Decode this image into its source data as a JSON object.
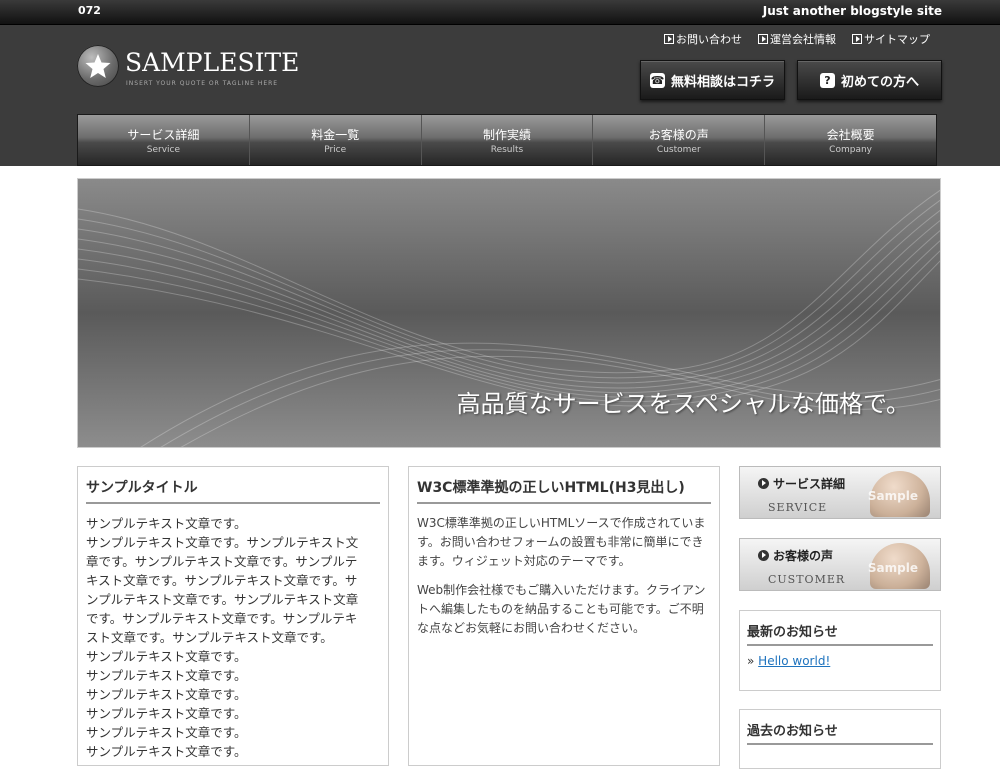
{
  "topbar": {
    "number": "072",
    "tagline": "Just another blogstyle site"
  },
  "logo": {
    "name": "SAMPLESITE",
    "tagline": "INSERT YOUR QUOTE OR TAGLINE HERE"
  },
  "toplinks": [
    {
      "label": "お問い合わせ",
      "icon": "arrow-box-icon"
    },
    {
      "label": "運営会社情報",
      "icon": "arrow-box-icon"
    },
    {
      "label": "サイトマップ",
      "icon": "arrow-box-icon"
    }
  ],
  "cta": {
    "consult": {
      "label": "無料相談はコチラ",
      "icon": "phone-icon"
    },
    "first": {
      "label": "初めての方へ",
      "icon": "question-icon"
    }
  },
  "nav": [
    {
      "jp": "サービス詳細",
      "en": "Service"
    },
    {
      "jp": "料金一覧",
      "en": "Price"
    },
    {
      "jp": "制作実績",
      "en": "Results"
    },
    {
      "jp": "お客様の声",
      "en": "Customer"
    },
    {
      "jp": "会社概要",
      "en": "Company"
    }
  ],
  "hero": {
    "text": "高品質なサービスをスペシャルな価格で。"
  },
  "col1": {
    "title": "サンプルタイトル",
    "lines": [
      "サンプルテキスト文章です。",
      "サンプルテキスト文章です。サンプルテキスト文",
      "章です。サンプルテキスト文章です。サンプルテ",
      "キスト文章です。サンプルテキスト文章です。サ",
      "ンプルテキスト文章です。サンプルテキスト文章",
      "です。サンプルテキスト文章です。サンプルテキ",
      "スト文章です。サンプルテキスト文章です。",
      "サンプルテキスト文章です。",
      "サンプルテキスト文章です。",
      "サンプルテキスト文章です。",
      "サンプルテキスト文章です。",
      "サンプルテキスト文章です。",
      "サンプルテキスト文章です。"
    ]
  },
  "col2": {
    "title": "W3C標準準拠の正しいHTML(H3見出し)",
    "p1": "W3C標準準拠の正しいHTMLソースで作成されています。お問い合わせフォームの設置も非常に簡単にできます。ウィジェット対応のテーマです。",
    "p2": "Web制作会社様でもご購入いただけます。クライアントへ編集したものを納品することも可能です。ご不明な点などお気軽にお問い合わせください。"
  },
  "banners": [
    {
      "title": "サービス詳細",
      "sub": "SERVICE",
      "overlay": "Sample"
    },
    {
      "title": "お客様の声",
      "sub": "CUSTOMER",
      "overlay": "Sample"
    }
  ],
  "news": {
    "title": "最新のお知らせ",
    "bullet": "»",
    "item": "Hello world!"
  },
  "past": {
    "title": "過去のお知らせ"
  }
}
